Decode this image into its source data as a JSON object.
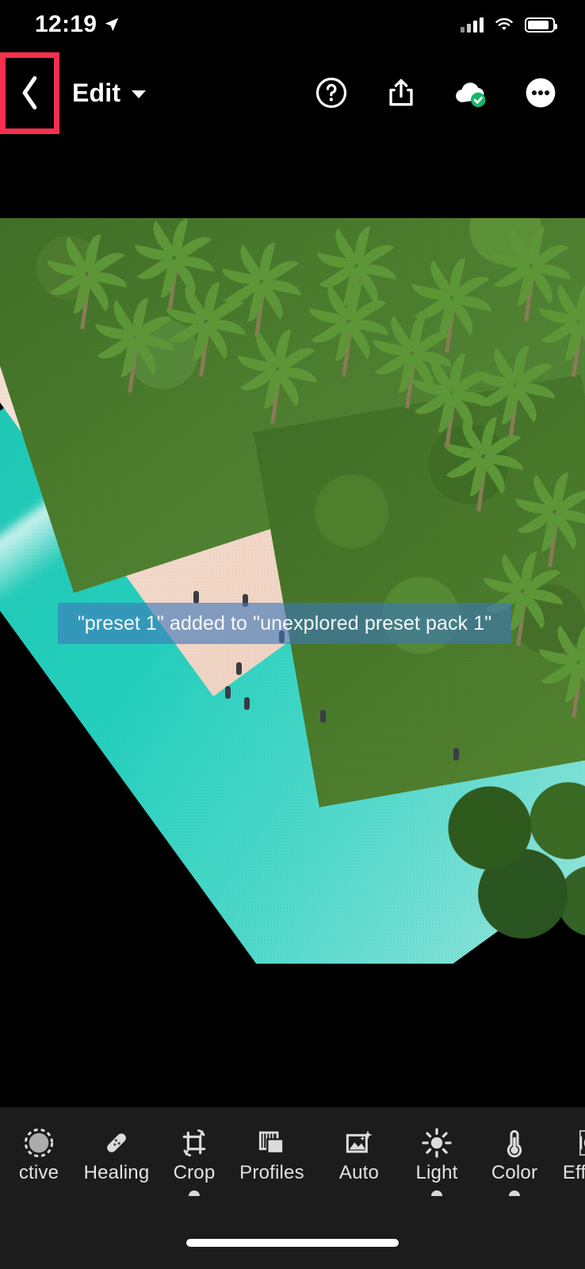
{
  "status_bar": {
    "time": "12:19",
    "location_icon": "location-arrow-icon",
    "cellular_icon": "cellular-signal-icon",
    "wifi_icon": "wifi-icon",
    "battery_icon": "battery-icon"
  },
  "nav_bar": {
    "back_icon": "chevron-left-icon",
    "title": "Edit",
    "title_caret_icon": "chevron-down-icon",
    "actions": [
      {
        "name": "help-icon",
        "label": "Help"
      },
      {
        "name": "share-icon",
        "label": "Share"
      },
      {
        "name": "cloud-synced-icon",
        "label": "Cloud Synced"
      },
      {
        "name": "more-options-icon",
        "label": "More"
      }
    ],
    "highlight_color": "#f8304f"
  },
  "toast": {
    "message": "\"preset 1\" added to \"unexplored preset pack 1\"",
    "background_color": "#3d78b9"
  },
  "toolbar": {
    "left_group": [
      {
        "label": "ctive",
        "icon": "selective-icon",
        "indicator": false
      },
      {
        "label": "Healing",
        "icon": "healing-bandage-icon",
        "indicator": false
      },
      {
        "label": "Crop",
        "icon": "crop-rotate-icon",
        "indicator": true
      },
      {
        "label": "Profiles",
        "icon": "profiles-stack-icon",
        "indicator": false
      }
    ],
    "right_group": [
      {
        "label": "Auto",
        "icon": "auto-enhance-icon",
        "indicator": false
      },
      {
        "label": "Light",
        "icon": "sun-icon",
        "indicator": true
      },
      {
        "label": "Color",
        "icon": "thermometer-icon",
        "indicator": true
      },
      {
        "label": "Effects",
        "icon": "effects-vignette-icon",
        "indicator": false
      }
    ]
  },
  "home_indicator": "home-indicator-bar"
}
